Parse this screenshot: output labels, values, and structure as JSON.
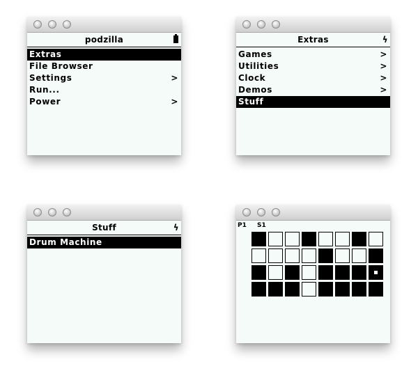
{
  "windows": {
    "main": {
      "title": "podzilla",
      "items": [
        {
          "label": "Extras",
          "selected": true,
          "submenu": false
        },
        {
          "label": "File Browser",
          "selected": false,
          "submenu": false
        },
        {
          "label": "Settings",
          "selected": false,
          "submenu": true
        },
        {
          "label": "Run...",
          "selected": false,
          "submenu": false
        },
        {
          "label": "Power",
          "selected": false,
          "submenu": true
        }
      ],
      "status_icon": "battery-icon"
    },
    "extras": {
      "title": "Extras",
      "items": [
        {
          "label": "Games",
          "selected": false,
          "submenu": true
        },
        {
          "label": "Utilities",
          "selected": false,
          "submenu": true
        },
        {
          "label": "Clock",
          "selected": false,
          "submenu": true
        },
        {
          "label": "Demos",
          "selected": false,
          "submenu": true
        },
        {
          "label": "Stuff",
          "selected": true,
          "submenu": false
        }
      ],
      "status_icon": "lightning-icon"
    },
    "stuff": {
      "title": "Stuff",
      "items": [
        {
          "label": "Drum Machine",
          "selected": true,
          "submenu": false
        }
      ],
      "status_icon": "lightning-icon"
    },
    "drum": {
      "pattern_label": "P1",
      "step_label": "S1",
      "grid": [
        [
          1,
          0,
          0,
          1,
          0,
          0,
          1,
          0
        ],
        [
          0,
          0,
          0,
          0,
          1,
          0,
          0,
          1
        ],
        [
          1,
          0,
          1,
          0,
          1,
          1,
          1,
          2
        ],
        [
          1,
          1,
          1,
          0,
          1,
          1,
          1,
          1
        ]
      ]
    }
  },
  "glyphs": {
    "arrow": ">",
    "lightning": "ϟ"
  },
  "colors": {
    "screen_bg": "#f4fbf8",
    "selection_bg": "#000000",
    "selection_fg": "#ffffff"
  }
}
